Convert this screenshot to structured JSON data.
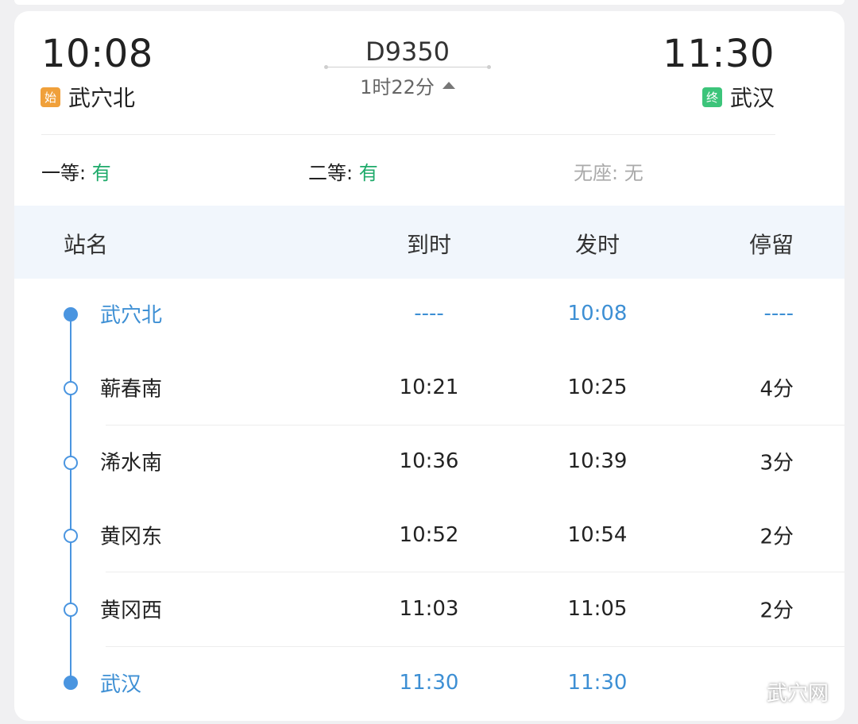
{
  "header": {
    "departure_time": "10:08",
    "arrival_time": "11:30",
    "departure_tag": "始",
    "arrival_tag": "终",
    "departure_station": "武穴北",
    "arrival_station": "武汉",
    "train_number": "D9350",
    "duration": "1时22分"
  },
  "seats": [
    {
      "label": "一等: ",
      "status": "有"
    },
    {
      "label": "二等: ",
      "status": "有"
    },
    {
      "label": "无座: ",
      "status": "无"
    }
  ],
  "table": {
    "columns": [
      "站名",
      "到时",
      "发时",
      "停留"
    ],
    "rows": [
      {
        "name": "武穴北",
        "arrive": "----",
        "depart": "10:08",
        "stay": "----"
      },
      {
        "name": "蕲春南",
        "arrive": "10:21",
        "depart": "10:25",
        "stay": "4分"
      },
      {
        "name": "浠水南",
        "arrive": "10:36",
        "depart": "10:39",
        "stay": "3分"
      },
      {
        "name": "黄冈东",
        "arrive": "10:52",
        "depart": "10:54",
        "stay": "2分"
      },
      {
        "name": "黄冈西",
        "arrive": "11:03",
        "depart": "11:05",
        "stay": "2分"
      },
      {
        "name": "武汉",
        "arrive": "11:30",
        "depart": "11:30",
        "stay": ""
      }
    ]
  },
  "watermark": "武穴网",
  "colors": {
    "accent_blue": "#3d8fd4",
    "available_green": "#1eaa6a",
    "start_tag": "#f0a03a",
    "end_tag": "#3cc47a"
  }
}
